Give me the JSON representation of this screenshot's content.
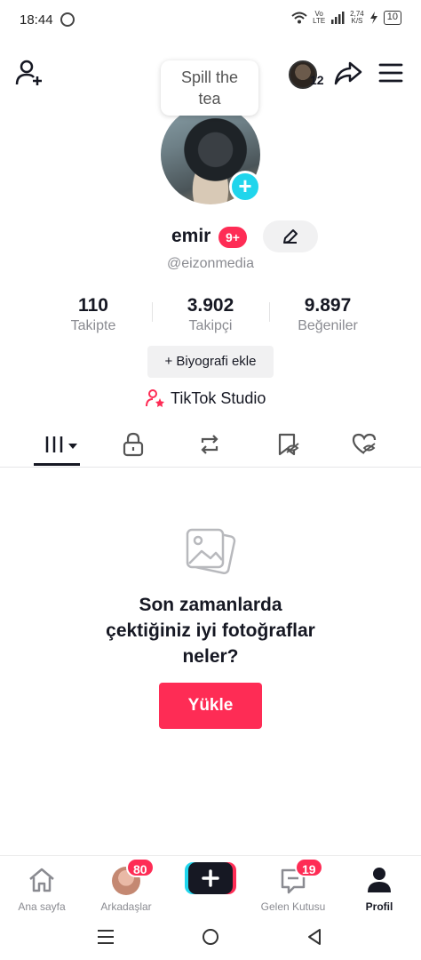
{
  "status_bar": {
    "time": "18:44",
    "net_top": "Vo",
    "net_bottom": "LTE",
    "speed_top": "2,74",
    "speed_bottom": "K/S",
    "battery": "10"
  },
  "header": {
    "bubble_text_line1": "Spill the",
    "bubble_text_line2": "tea",
    "notif_count": "12"
  },
  "profile": {
    "name": "emir",
    "name_badge": "9+",
    "handle": "@eizonmedia"
  },
  "stats": [
    {
      "value": "110",
      "label": "Takipte"
    },
    {
      "value": "3.902",
      "label": "Takipçi"
    },
    {
      "value": "9.897",
      "label": "Beğeniler"
    }
  ],
  "bio_button": "+ Biyografi ekle",
  "studio_label": "TikTok Studio",
  "empty_state": {
    "line1": "Son zamanlarda",
    "line2": "çektiğiniz iyi fotoğraflar",
    "line3": "neler?",
    "button": "Yükle"
  },
  "bottom_nav": {
    "home": "Ana sayfa",
    "friends": "Arkadaşlar",
    "friends_badge": "80",
    "inbox": "Gelen Kutusu",
    "inbox_badge": "19",
    "profile": "Profil"
  },
  "colors": {
    "accent": "#fe2c55",
    "cyan": "#20d5ec",
    "text": "#161823",
    "muted": "#8a8b91"
  }
}
